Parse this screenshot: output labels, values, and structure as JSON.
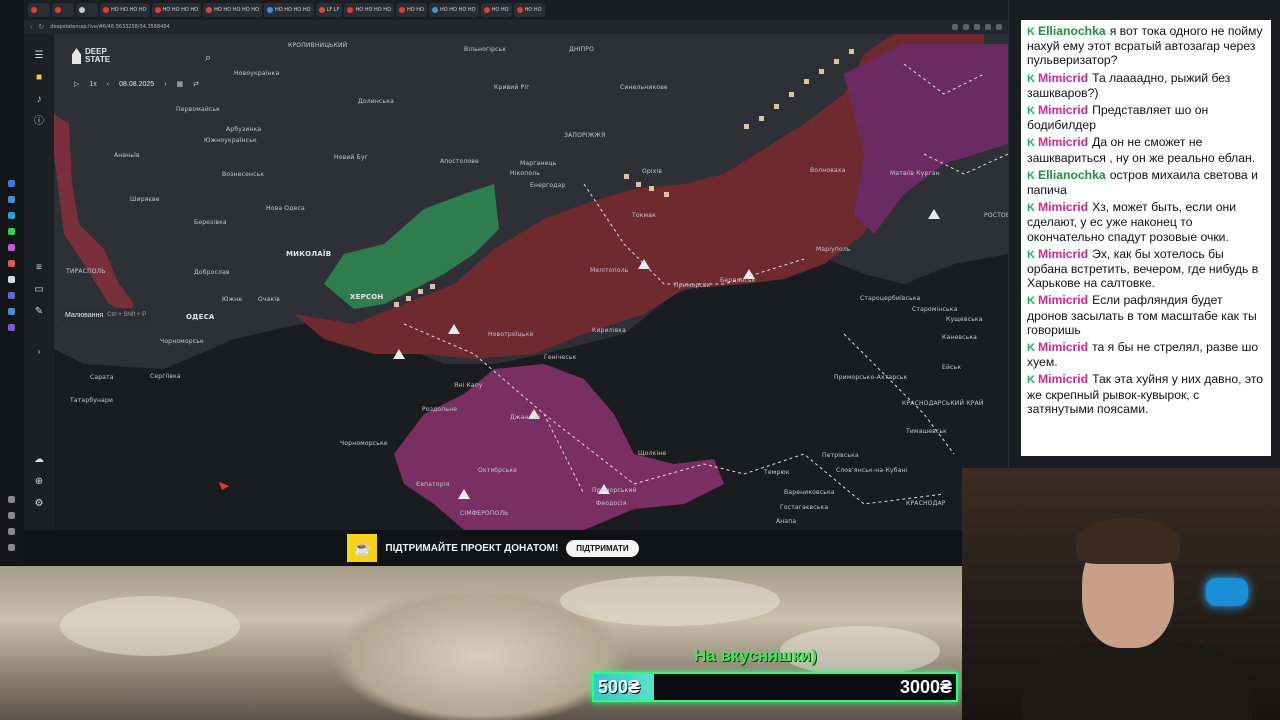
{
  "browser": {
    "url": "deepstatemap.live/#6/46.5633258/34.3568484",
    "tabs": [
      {
        "color": "#e23b3b",
        "label": ""
      },
      {
        "color": "#e23b3b",
        "label": ""
      },
      {
        "color": "#c9c9c9",
        "label": ""
      },
      {
        "color": "#e23b3b",
        "label": "HO HO HO HO"
      },
      {
        "color": "#e23b3b",
        "label": "HO HO HO HO"
      },
      {
        "color": "#d84a4a",
        "label": "HO HO HO HO HO"
      },
      {
        "color": "#4a8fd8",
        "label": "HO HO HO HO"
      },
      {
        "color": "#d84a4a",
        "label": "LF LF"
      },
      {
        "color": "#e23b3b",
        "label": "HO HO HO HO"
      },
      {
        "color": "#e23b3b",
        "label": "HO HO"
      },
      {
        "color": "#4a8fd8",
        "label": "HO HO HO HO"
      },
      {
        "color": "#e23b3b",
        "label": "HO HO"
      },
      {
        "color": "#e23b3b",
        "label": "HO HO"
      }
    ]
  },
  "app": {
    "brand": "DEEP STATE",
    "speed": "1x",
    "date": "08.08.2025",
    "tooltip": {
      "label": "Малювання",
      "shortcut": "Ctrl + Shift + P"
    }
  },
  "map": {
    "labels": [
      {
        "t": "КРОПИВНИЦЬКИЙ",
        "big": false
      },
      {
        "t": "Новоукраїнка",
        "big": false
      },
      {
        "t": "Вільногірськ",
        "big": false
      },
      {
        "t": "ДНІПРО",
        "big": false
      },
      {
        "t": "ЗАПОРІЖЖЯ",
        "big": false
      },
      {
        "t": "Синельникове",
        "big": false
      },
      {
        "t": "Кривий Ріг",
        "big": false
      },
      {
        "t": "Долинська",
        "big": false
      },
      {
        "t": "Первомайськ",
        "big": false
      },
      {
        "t": "Арбузинка",
        "big": false
      },
      {
        "t": "Южноукраїнськ",
        "big": false
      },
      {
        "t": "Ананьїв",
        "big": false
      },
      {
        "t": "Вознесенськ",
        "big": false
      },
      {
        "t": "Новий Буг",
        "big": false
      },
      {
        "t": "Апостолове",
        "big": false
      },
      {
        "t": "Марганець",
        "big": false
      },
      {
        "t": "Нікополь",
        "big": false
      },
      {
        "t": "Енергодар",
        "big": false
      },
      {
        "t": "Оріхів",
        "big": false
      },
      {
        "t": "Токмак",
        "big": false
      },
      {
        "t": "Волноваха",
        "big": false
      },
      {
        "t": "Матвіїв Курган",
        "big": false
      },
      {
        "t": "РОСТОВ-НА-ДОНУ",
        "big": false
      },
      {
        "t": "Ширяєве",
        "big": false
      },
      {
        "t": "Березівка",
        "big": false
      },
      {
        "t": "Нова Одеса",
        "big": false
      },
      {
        "t": "МИКОЛАЇВ",
        "big": true
      },
      {
        "t": "ТИРАСПОЛЬ",
        "big": false
      },
      {
        "t": "Доброслав",
        "big": false
      },
      {
        "t": "Южне",
        "big": false
      },
      {
        "t": "Очаків",
        "big": false
      },
      {
        "t": "ОДЕСА",
        "big": true
      },
      {
        "t": "ХЕРСОН",
        "big": true
      },
      {
        "t": "Чорноморськ",
        "big": false
      },
      {
        "t": "Мелітополь",
        "big": false
      },
      {
        "t": "Приморськ",
        "big": false
      },
      {
        "t": "Бердянськ",
        "big": false
      },
      {
        "t": "Маріуполь",
        "big": false
      },
      {
        "t": "Новотроїцьке",
        "big": false
      },
      {
        "t": "Генічеськ",
        "big": false
      },
      {
        "t": "Кирилівка",
        "big": false
      },
      {
        "t": "Сарата",
        "big": false
      },
      {
        "t": "Сергіївка",
        "big": false
      },
      {
        "t": "Татарбунари",
        "big": false
      },
      {
        "t": "Роздольне",
        "big": false
      },
      {
        "t": "Джанкой",
        "big": false
      },
      {
        "t": "Чорноморське",
        "big": false
      },
      {
        "t": "Октябрське",
        "big": false
      },
      {
        "t": "Євпаторія",
        "big": false
      },
      {
        "t": "Приморський",
        "big": false
      },
      {
        "t": "Феодосія",
        "big": false
      },
      {
        "t": "СІМФЕРОПОЛЬ",
        "big": false
      },
      {
        "t": "Щолкіне",
        "big": false
      },
      {
        "t": "Темрюк",
        "big": false
      },
      {
        "t": "Петрівська",
        "big": false
      },
      {
        "t": "Слов'янськ-на-Кубані",
        "big": false
      },
      {
        "t": "Тимашевськ",
        "big": false
      },
      {
        "t": "Приморсько-Ахтарськ",
        "big": false
      },
      {
        "t": "КРАСНОДАРСЬКИЙ КРАЙ",
        "big": false
      },
      {
        "t": "Староцербиївська",
        "big": false
      },
      {
        "t": "Старомінська",
        "big": false
      },
      {
        "t": "Кущевська",
        "big": false
      },
      {
        "t": "Каневська",
        "big": false
      },
      {
        "t": "Ейськ",
        "big": false
      },
      {
        "t": "Гостагаєвська",
        "big": false
      },
      {
        "t": "Варениковська",
        "big": false
      },
      {
        "t": "Анапа",
        "big": false
      },
      {
        "t": "КРАСНОДАР",
        "big": false
      },
      {
        "t": "Яні Капу",
        "big": false
      }
    ]
  },
  "donate": {
    "text": "ПІДТРИМАЙТЕ ПРОЕКТ ДОНАТОМ!",
    "button": "ПІДТРИМАТИ"
  },
  "chat": {
    "badge": "K",
    "messages": [
      {
        "user": "Ellianochka",
        "color": "#1f8f3a",
        "text": "я вот тока одного не пойму нахуй ему этот всратый автозагар через пульверизатор?"
      },
      {
        "user": "Mimicrid",
        "color": "#d02a8a",
        "text": "Та лаааадно, рыжий без зашкваров?)"
      },
      {
        "user": "Mimicrid",
        "color": "#d02a8a",
        "text": "Представляет шо он бодибилдер"
      },
      {
        "user": "Mimicrid",
        "color": "#d02a8a",
        "text": "Да он не сможет не зашквариться , ну он же реально еблан."
      },
      {
        "user": "Ellianochka",
        "color": "#1f8f3a",
        "text": "остров михаила светова и папича"
      },
      {
        "user": "Mimicrid",
        "color": "#d02a8a",
        "text": "Хз, может быть, если они сделают, у ес уже наконец то окончательно спадут розовые очки."
      },
      {
        "user": "Mimicrid",
        "color": "#d02a8a",
        "text": "Эх, как бы хотелось бы орбана встретить, вечером, где нибудь в Харькове на салтовке."
      },
      {
        "user": "Mimicrid",
        "color": "#d02a8a",
        "text": "Если рафляндия будет дронов засылать в том масштабе как ты говоришь"
      },
      {
        "user": "Mimicrid",
        "color": "#d02a8a",
        "text": "та я бы не стрелял, разве шо хуем."
      },
      {
        "user": "Mimicrid",
        "color": "#d02a8a",
        "text": "Так эта хуйня у них давно, это же скрепный рывок-кувырок, с затянутыми поясами."
      }
    ]
  },
  "goal": {
    "title": "На вкусняшки)",
    "current": "500₴",
    "target": "3000₴",
    "progress": 0.1667
  }
}
